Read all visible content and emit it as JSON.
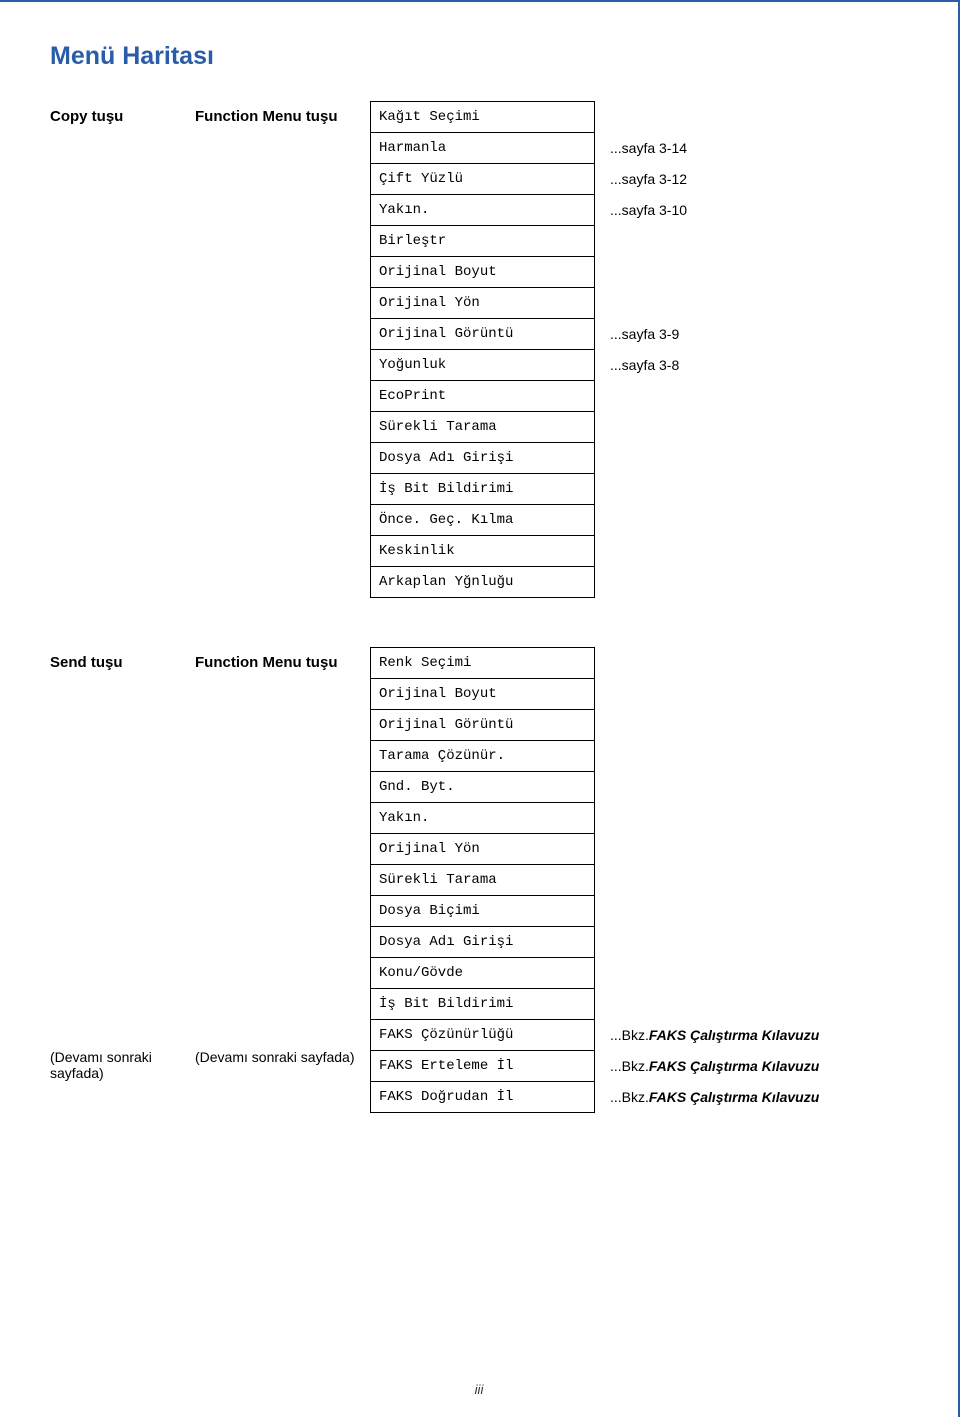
{
  "title": "Menü Haritası",
  "section1": {
    "key": "Copy tuşu",
    "fn": "Function Menu tuşu",
    "items": [
      {
        "label": "Kağıt Seçimi",
        "ref": ""
      },
      {
        "label": "Harmanla",
        "ref": "...sayfa 3-14"
      },
      {
        "label": "Çift Yüzlü",
        "ref": "...sayfa 3-12"
      },
      {
        "label": "Yakın.",
        "ref": "...sayfa 3-10"
      },
      {
        "label": "Birleştr",
        "ref": ""
      },
      {
        "label": "Orijinal Boyut",
        "ref": ""
      },
      {
        "label": "Orijinal Yön",
        "ref": ""
      },
      {
        "label": "Orijinal Görüntü",
        "ref": "...sayfa 3-9"
      },
      {
        "label": "Yoğunluk",
        "ref": "...sayfa 3-8"
      },
      {
        "label": "EcoPrint",
        "ref": ""
      },
      {
        "label": "Sürekli Tarama",
        "ref": ""
      },
      {
        "label": "Dosya Adı Girişi",
        "ref": ""
      },
      {
        "label": "İş Bit Bildirimi",
        "ref": ""
      },
      {
        "label": "Önce. Geç. Kılma",
        "ref": ""
      },
      {
        "label": "Keskinlik",
        "ref": ""
      },
      {
        "label": "Arkaplan Yğnluğu",
        "ref": ""
      }
    ]
  },
  "section2": {
    "key": "Send tuşu",
    "fn": "Function Menu tuşu",
    "keyNote": "(Devamı sonraki sayfada)",
    "fnNote": "(Devamı sonraki sayfada)",
    "items": [
      {
        "label": "Renk Seçimi",
        "ref": ""
      },
      {
        "label": "Orijinal Boyut",
        "ref": ""
      },
      {
        "label": "Orijinal Görüntü",
        "ref": ""
      },
      {
        "label": "Tarama Çözünür.",
        "ref": ""
      },
      {
        "label": "Gnd. Byt.",
        "ref": ""
      },
      {
        "label": "Yakın.",
        "ref": ""
      },
      {
        "label": "Orijinal Yön",
        "ref": ""
      },
      {
        "label": "Sürekli Tarama",
        "ref": ""
      },
      {
        "label": "Dosya Biçimi",
        "ref": ""
      },
      {
        "label": "Dosya Adı Girişi",
        "ref": ""
      },
      {
        "label": "Konu/Gövde",
        "ref": ""
      },
      {
        "label": "İş Bit Bildirimi",
        "ref": ""
      },
      {
        "label": "FAKS Çözünürlüğü",
        "ref": "...Bkz. ",
        "refItalic": "FAKS Çalıştırma Kılavuzu"
      },
      {
        "label": "FAKS Erteleme İl",
        "ref": "...Bkz. ",
        "refItalic": "FAKS Çalıştırma Kılavuzu"
      },
      {
        "label": "FAKS Doğrudan İl",
        "ref": "...Bkz. ",
        "refItalic": "FAKS Çalıştırma Kılavuzu"
      }
    ]
  },
  "pagenum": "iii"
}
